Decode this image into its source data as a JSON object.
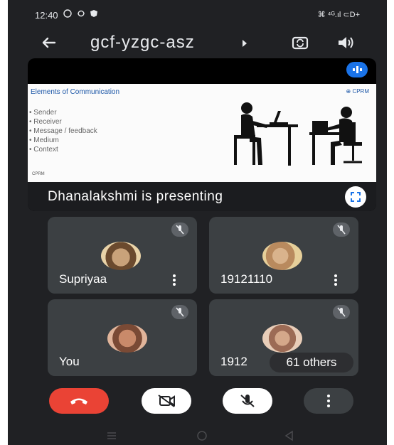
{
  "status_bar": {
    "time": "12:40",
    "left_icons": [
      "whatsapp-icon",
      "sync-icon",
      "shield-icon"
    ],
    "right_text": "⌘ ⁴ᴳ.ıl ⊂D+"
  },
  "top_bar": {
    "meeting_code": "gcf-yzgc-asz"
  },
  "presentation": {
    "slide_title": "Elements of Communication",
    "slide_logo": "⊕ CPRM",
    "slide_items": [
      "Sender",
      "Receiver",
      "Message / feedback",
      "Medium",
      "Context"
    ],
    "slide_footer": "CPRM",
    "presenting_text": "Dhanalakshmi is presenting"
  },
  "participants": [
    {
      "name": "Supriyaa",
      "muted": true
    },
    {
      "name": "19121110",
      "muted": true
    },
    {
      "name": "You",
      "muted": true
    },
    {
      "name": "1912",
      "muted": true
    }
  ],
  "others_badge": "61 others",
  "controls": {
    "end_call_color": "#ea4335",
    "button_color": "#ffffff",
    "more_button_color": "#3c4043"
  }
}
